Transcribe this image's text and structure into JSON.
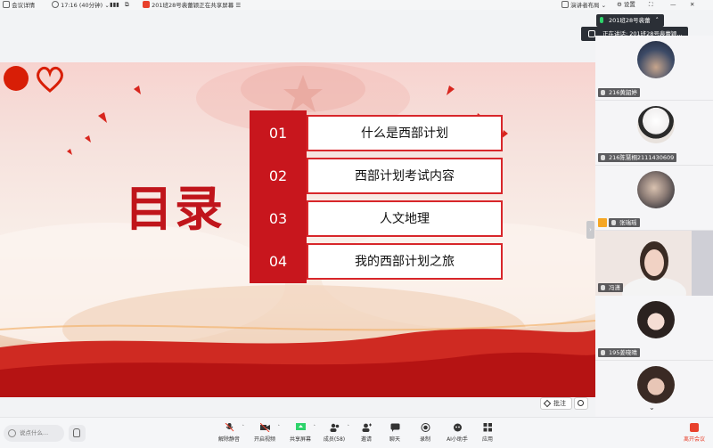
{
  "topbar": {
    "meeting_details": "会议详情",
    "time_info": "17:16 (40分钟)",
    "sharing_status": "201班28号裴蕾颖正在共享屏幕",
    "layout_button": "演讲者布局",
    "settings_button": "设置"
  },
  "speaking": {
    "tag": "201班28号裴蕾",
    "popup": "正在讲话: 201班28号裴蕾颖..."
  },
  "slide": {
    "title": "目录",
    "toc": [
      {
        "num": "01",
        "text": "什么是西部计划"
      },
      {
        "num": "02",
        "text": "西部计划考试内容"
      },
      {
        "num": "03",
        "text": "人文地理"
      },
      {
        "num": "04",
        "text": "我的西部计划之旅"
      }
    ],
    "annotate_button": "批注"
  },
  "participants": [
    {
      "name": "216黄韶婷"
    },
    {
      "name": "216陈慧桐2111430609"
    },
    {
      "name": "张瑞瑶"
    },
    {
      "name": "冯潇"
    },
    {
      "name": "195姜晓晴"
    },
    {
      "name": ""
    }
  ],
  "bottombar": {
    "chat_placeholder": "说点什么...",
    "tools": [
      {
        "label": "解除静音"
      },
      {
        "label": "开启视频"
      },
      {
        "label": "共享屏幕"
      },
      {
        "label": "成员(58)"
      },
      {
        "label": "邀请"
      },
      {
        "label": "聊天"
      },
      {
        "label": "录制"
      },
      {
        "label": "AI小助手"
      },
      {
        "label": "应用"
      }
    ],
    "leave_label": "离开会议"
  },
  "colors": {
    "accent_red": "#c8161d",
    "speaking_green": "#2ed36b",
    "leave_red": "#e8412c"
  }
}
